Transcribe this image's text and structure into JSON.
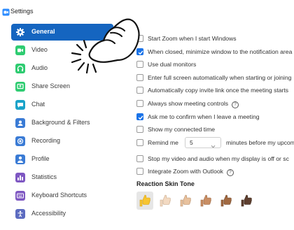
{
  "window": {
    "title": "Settings"
  },
  "sidebar": {
    "items": [
      {
        "label": "General",
        "icon": "gear-icon",
        "color": "#ffffff",
        "active": true
      },
      {
        "label": "Video",
        "icon": "video-icon",
        "color": "#2ecc71"
      },
      {
        "label": "Audio",
        "icon": "headphones-icon",
        "color": "#2ecc71"
      },
      {
        "label": "Share Screen",
        "icon": "share-screen-icon",
        "color": "#2ecc71"
      },
      {
        "label": "Chat",
        "icon": "chat-icon",
        "color": "#1aa3c9"
      },
      {
        "label": "Background & Filters",
        "icon": "person-background-icon",
        "color": "#3a7bd5"
      },
      {
        "label": "Recording",
        "icon": "recording-icon",
        "color": "#3a7bd5"
      },
      {
        "label": "Profile",
        "icon": "profile-icon",
        "color": "#3a7bd5"
      },
      {
        "label": "Statistics",
        "icon": "statistics-icon",
        "color": "#7e57c2"
      },
      {
        "label": "Keyboard Shortcuts",
        "icon": "keyboard-icon",
        "color": "#7e57c2"
      },
      {
        "label": "Accessibility",
        "icon": "accessibility-icon",
        "color": "#5c6bc0"
      }
    ]
  },
  "general": {
    "options": [
      {
        "label": "Start Zoom when I start Windows",
        "checked": false
      },
      {
        "label": "When closed, minimize window to the notification area",
        "checked": true
      },
      {
        "label": "Use dual monitors",
        "checked": false
      },
      {
        "label": "Enter full screen automatically when starting or joining",
        "checked": false
      },
      {
        "label": "Automatically copy invite link once the meeting starts",
        "checked": false
      },
      {
        "label": "Always show meeting controls",
        "checked": false,
        "help": true
      },
      {
        "label": "Ask me to confirm when I leave a meeting",
        "checked": true
      },
      {
        "label": "Show my connected time",
        "checked": false
      },
      {
        "label": "Remind me",
        "checked": false,
        "select_value": "5",
        "after_label": "minutes before my upcoming m"
      },
      {
        "label": "Stop my video and audio when my display is off or sc",
        "checked": false
      },
      {
        "label": "Integrate Zoom with Outlook",
        "checked": false,
        "help": true
      }
    ],
    "help_glyph": "?",
    "reaction_heading": "Reaction Skin Tone",
    "skin_tones": [
      {
        "color": "#f7c531",
        "selected": true
      },
      {
        "color": "#f3dac2"
      },
      {
        "color": "#e8c19d"
      },
      {
        "color": "#c98e64"
      },
      {
        "color": "#a26a42"
      },
      {
        "color": "#5f4030"
      }
    ]
  },
  "colors": {
    "accent": "#1565c0",
    "checkbox_on": "#1a73e8"
  }
}
